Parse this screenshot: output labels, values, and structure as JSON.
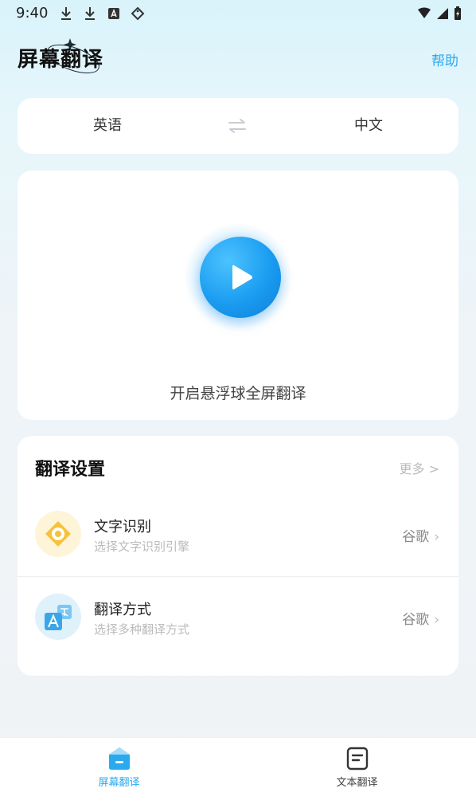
{
  "status_bar": {
    "time": "9:40",
    "left_icons": [
      "download-icon",
      "download-icon",
      "font-icon",
      "tag-icon"
    ],
    "right_icons": [
      "wifi-icon",
      "signal-icon",
      "battery-charging-icon"
    ]
  },
  "header": {
    "title": "屏幕翻译",
    "help": "帮助"
  },
  "language": {
    "source": "英语",
    "swap_icon": "swap-arrows-icon",
    "target": "中文"
  },
  "floating": {
    "label": "开启悬浮球全屏翻译"
  },
  "settings": {
    "title": "翻译设置",
    "more": "更多 >",
    "items": [
      {
        "title": "文字识别",
        "subtitle": "选择文字识别引擎",
        "value": "谷歌",
        "icon": "target-icon"
      },
      {
        "title": "翻译方式",
        "subtitle": "选择多种翻译方式",
        "value": "谷歌",
        "icon": "translate-icon"
      }
    ]
  },
  "nav": {
    "items": [
      {
        "label": "屏幕翻译",
        "icon": "home-icon",
        "active": true
      },
      {
        "label": "文本翻译",
        "icon": "document-icon",
        "active": false
      }
    ]
  },
  "colors": {
    "accent": "#29a9ee",
    "play_button": "#1a9cf0",
    "ocr_icon": "#f7c23a",
    "translate_icon": "#3aa6ea"
  }
}
